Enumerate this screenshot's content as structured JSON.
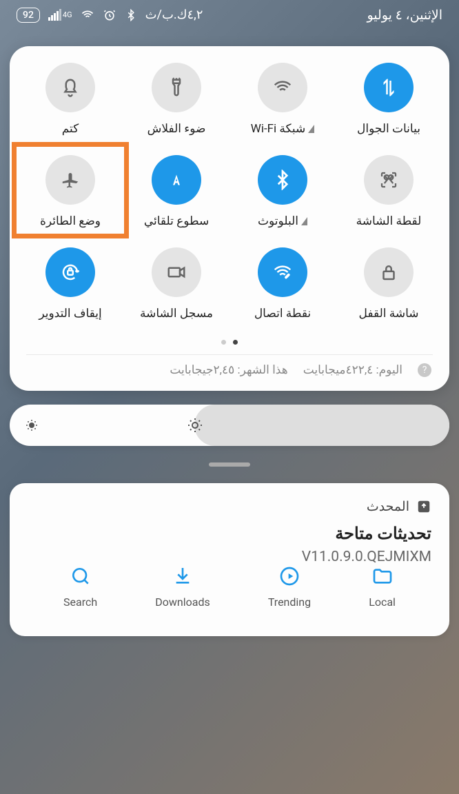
{
  "status": {
    "battery": "92",
    "net_label": "4G",
    "time_ar": "٤,٢ك.ب/ث",
    "date": "الإثنين، ٤ يوليو"
  },
  "tiles": [
    {
      "id": "mobile-data",
      "label": "بيانات الجوال",
      "on": true
    },
    {
      "id": "wifi",
      "label": "شبكة Wi-Fi",
      "on": false,
      "tri": true
    },
    {
      "id": "flashlight",
      "label": "ضوء الفلاش",
      "on": false
    },
    {
      "id": "mute",
      "label": "كتم",
      "on": false
    },
    {
      "id": "screenshot",
      "label": "لقطة الشاشة",
      "on": false
    },
    {
      "id": "bluetooth",
      "label": "البلوتوث",
      "on": true,
      "tri": true
    },
    {
      "id": "auto-brightness",
      "label": "سطوع تلقائي",
      "on": true
    },
    {
      "id": "airplane",
      "label": "وضع الطائرة",
      "on": false,
      "highlight": true
    },
    {
      "id": "lock-screen",
      "label": "شاشة القفل",
      "on": false
    },
    {
      "id": "hotspot",
      "label": "نقطة اتصال",
      "on": true
    },
    {
      "id": "screen-record",
      "label": "مسجل الشاشة",
      "on": false
    },
    {
      "id": "rotation-lock",
      "label": "إيقاف التدوير",
      "on": true
    }
  ],
  "usage": {
    "today": "اليوم: ٤٢٢,٤ميجابايت",
    "month": "هذا الشهر: ٢,٤٥جيجابايت"
  },
  "notif": {
    "app": "المحدث",
    "title": "تحديثات متاحة",
    "version": "V11.0.9.0.QEJMIXM"
  },
  "bottom": [
    {
      "id": "search",
      "label": "Search"
    },
    {
      "id": "downloads",
      "label": "Downloads"
    },
    {
      "id": "trending",
      "label": "Trending"
    },
    {
      "id": "local",
      "label": "Local"
    }
  ]
}
